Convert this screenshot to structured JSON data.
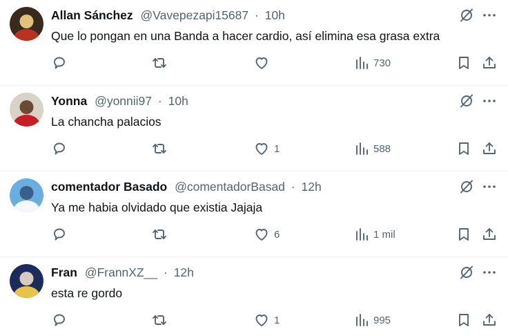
{
  "replies": [
    {
      "name": "Allan Sánchez",
      "handle": "@Vavepezapi15687",
      "separator": "·",
      "time": "10h",
      "text": "Que lo pongan en una Banda a hacer cardio, así elimina esa grasa extra",
      "likes": "",
      "views": "730",
      "avatar_colors": [
        "#3a2a1e",
        "#b8331f",
        "#e0c27a"
      ]
    },
    {
      "name": "Yonna",
      "handle": "@yonnii97",
      "separator": "·",
      "time": "10h",
      "text": "La chancha palacios",
      "likes": "1",
      "views": "588",
      "avatar_colors": [
        "#d9d2c6",
        "#c71e25",
        "#6b4a35"
      ]
    },
    {
      "name": "comentador Basado",
      "handle": "@comentadorBasad",
      "separator": "·",
      "time": "12h",
      "text": "Ya me habia olvidado que existia Jajaja",
      "likes": "6",
      "views": "1 mil",
      "avatar_colors": [
        "#6aaee0",
        "#f4f7fb",
        "#3b5f8a"
      ]
    },
    {
      "name": "Fran",
      "handle": "@FrannXZ__",
      "separator": "·",
      "time": "12h",
      "text": "esta re gordo",
      "likes": "1",
      "views": "995",
      "avatar_colors": [
        "#1c2c5a",
        "#e9c24a",
        "#d7cbbd"
      ]
    }
  ],
  "icons": {
    "grok": "grok-slash-icon",
    "more": "more-horizontal-icon",
    "reply": "reply-bubble-icon",
    "retweet": "repost-icon",
    "like": "heart-icon",
    "views": "views-bar-chart-icon",
    "bookmark": "bookmark-icon",
    "share": "share-upload-icon"
  },
  "colors": {
    "text_primary": "#0f1419",
    "text_secondary": "#536471",
    "divider": "#eff3f4"
  }
}
